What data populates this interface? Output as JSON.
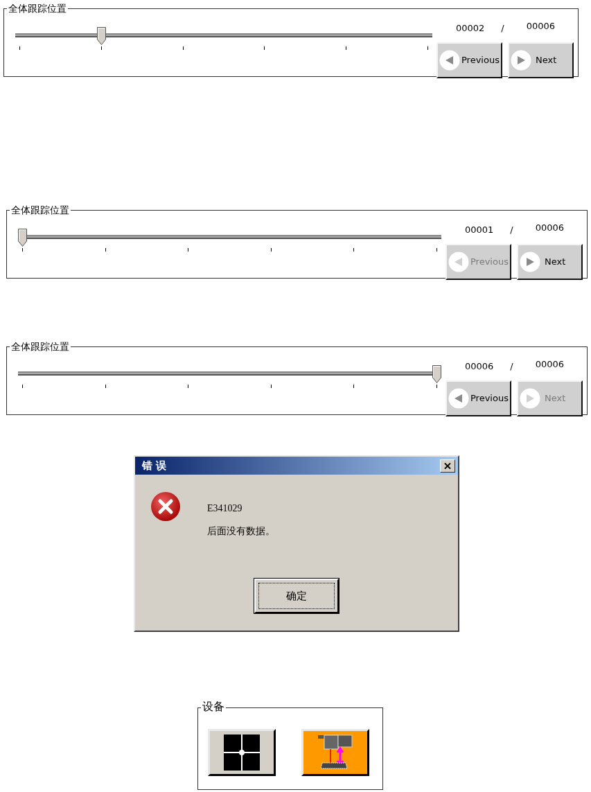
{
  "trackers": [
    {
      "title": "全体跟踪位置",
      "slider": {
        "level": 0.2
      },
      "current": "00002",
      "separator": "/",
      "total": "00006",
      "buttons": [
        {
          "kind": "previous",
          "label": "Previous",
          "disabled": false
        },
        {
          "kind": "next",
          "label": "Next",
          "disabled": false
        }
      ]
    },
    {
      "title": "全体跟踪位置",
      "slider": {
        "level": 0
      },
      "current": "00001",
      "separator": "/",
      "total": "00006",
      "buttons": [
        {
          "kind": "previous",
          "label": "Previous",
          "disabled": true
        },
        {
          "kind": "next",
          "label": "Next",
          "disabled": false
        }
      ]
    },
    {
      "title": "全体跟踪位置",
      "slider": {
        "level": 1
      },
      "current": "00006",
      "separator": "/",
      "total": "00006",
      "buttons": [
        {
          "kind": "previous",
          "label": "Previous",
          "disabled": false
        },
        {
          "kind": "next",
          "label": "Next",
          "disabled": true
        }
      ]
    }
  ],
  "error_dialog": {
    "title": "错 误",
    "code": "E341029",
    "message": "后面没有数据。",
    "ok_button": "确定"
  },
  "device_group": {
    "title": "设备",
    "buttons": [
      {
        "kind": "grid",
        "selected": false
      },
      {
        "kind": "probe",
        "selected": true
      }
    ]
  }
}
